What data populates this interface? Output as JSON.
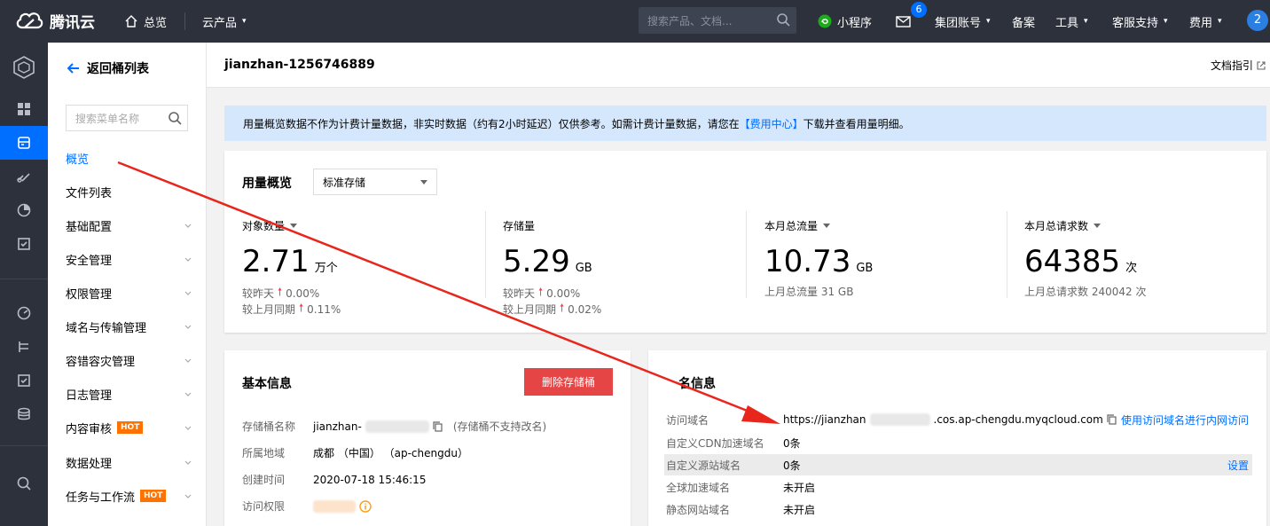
{
  "topbar": {
    "brand": "腾讯云",
    "overview": "总览",
    "products": "云产品",
    "search_placeholder": "搜索产品、文档...",
    "miniprogram": "小程序",
    "mail_count": "6",
    "group_account": "集团账号",
    "filing": "备案",
    "tools": "工具",
    "support": "客服支持",
    "billing": "费用",
    "user_badge": "2"
  },
  "sidebar_menu": {
    "back": "返回桶列表",
    "search_placeholder": "搜索菜单名称",
    "items": [
      {
        "label": "概览"
      },
      {
        "label": "文件列表"
      },
      {
        "label": "基础配置"
      },
      {
        "label": "安全管理"
      },
      {
        "label": "权限管理"
      },
      {
        "label": "域名与传输管理"
      },
      {
        "label": "容错容灾管理"
      },
      {
        "label": "日志管理"
      },
      {
        "label": "内容审核",
        "tag": "HOT"
      },
      {
        "label": "数据处理"
      },
      {
        "label": "任务与工作流",
        "tag": "HOT"
      }
    ]
  },
  "header": {
    "bucket_name": "jianzhan-1256746889",
    "doc_guide": "文档指引"
  },
  "notice": {
    "text_before": "用量概览数据不作为计费计量数据，非实时数据（约有2小时延迟）仅供参考。如需计费计量数据，请您在",
    "link": "【费用中心】",
    "text_after": "下载并查看用量明细。"
  },
  "usage": {
    "title": "用量概览",
    "storage_class": "标准存储",
    "metrics": [
      {
        "label": "对象数量",
        "has_dropdown": true,
        "value": "2.71",
        "unit": "万个",
        "sub1_label": "较昨天",
        "sub1_value": "0.00%",
        "sub2_label": "较上月同期",
        "sub2_value": "0.11%"
      },
      {
        "label": "存储量",
        "has_dropdown": false,
        "value": "5.29",
        "unit": "GB",
        "sub1_label": "较昨天",
        "sub1_value": "0.00%",
        "sub2_label": "较上月同期",
        "sub2_value": "0.02%"
      },
      {
        "label": "本月总流量",
        "has_dropdown": true,
        "value": "10.73",
        "unit": "GB",
        "sub1_text": "上月总流量 31 GB"
      },
      {
        "label": "本月总请求数",
        "has_dropdown": true,
        "value": "64385",
        "unit": "次",
        "sub1_text": "上月总请求数 240042 次"
      }
    ]
  },
  "basic_info": {
    "title": "基本信息",
    "delete_button": "删除存储桶",
    "bucket_name_label": "存储桶名称",
    "bucket_name_value": "jianzhan-",
    "bucket_name_hint": "(存储桶不支持改名)",
    "region_label": "所属地域",
    "region_value": "成都 （中国） （ap-chengdu）",
    "created_label": "创建时间",
    "created_value": "2020-07-18 15:46:15",
    "access_label": "访问权限"
  },
  "domain_info": {
    "title_visible": "名信息",
    "access_domain_label": "访问域名",
    "access_domain_prefix": "https://jianzhan",
    "access_domain_suffix": ".cos.ap-chengdu.myqcloud.com",
    "intranet_link": "使用访问域名进行内网访问",
    "cdn_label": "自定义CDN加速域名",
    "cdn_value": "0条",
    "origin_label": "自定义源站域名",
    "origin_value": "0条",
    "origin_action": "设置",
    "global_label": "全球加速域名",
    "global_value": "未开启",
    "static_label": "静态网站域名",
    "static_value": "未开启"
  },
  "colors": {
    "topbar": "#2c313c",
    "accent": "#006eff",
    "danger": "#e54545",
    "hot": "#ff7200",
    "annotation_arrow": "#e8261c"
  }
}
